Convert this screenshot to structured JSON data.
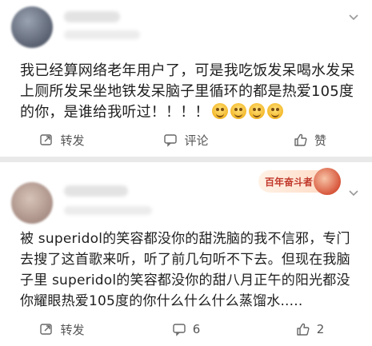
{
  "post1": {
    "content": "我已经算网络老年用户了，可是我吃饭发呆喝水发呆上厕所发呆坐地铁发呆脑子里循环的都是热爱105度的你，是谁给我听过！！！！",
    "emoji_icons": [
      "grin-emoji-icon",
      "grin-emoji-icon",
      "grin-emoji-icon",
      "grin-emoji-icon"
    ],
    "actions": {
      "repost": "转发",
      "comment": "评论",
      "like": "赞"
    }
  },
  "post2": {
    "badge_text": "百年奋斗者",
    "content": "被 superidol的笑容都没你的甜洗脑的我不信邪，专门去搜了这首歌来听，听了前几句听不下去。但现在我脑子里 superidol的笑容都没你的甜八月正午的阳光都没你耀眼热爱105度的你什么什么什么蒸馏水.....",
    "actions": {
      "repost": "转发",
      "comment": "6",
      "like": "2"
    }
  },
  "colors": {
    "background": "#e9e9e9",
    "card": "#ffffff",
    "text": "#1f1f1f",
    "muted": "#555555"
  }
}
